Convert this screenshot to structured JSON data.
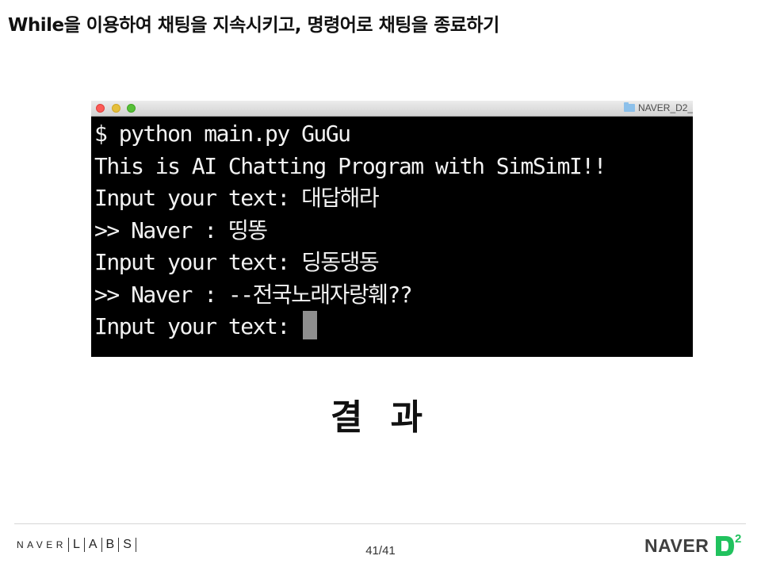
{
  "slide": {
    "title": "While을 이용하여 채팅을 지속시키고, 명령어로 채팅을 종료하기",
    "caption": "결 과",
    "page_number": "41/41"
  },
  "terminal": {
    "window_title": "NAVER_D2_",
    "lines": [
      "$ python main.py GuGu",
      "This is AI Chatting Program with SimSimI!!",
      "Input your text: 대답해라",
      "&gt;&gt; Naver : 띵똥",
      "Input your text: 딩동댕동",
      "&gt;&gt; Naver : --전국노래자랑훼??",
      "Input your text: "
    ]
  },
  "footer": {
    "labs_naver": "NAVER",
    "labs_letters": [
      "L",
      "A",
      "B",
      "S"
    ],
    "d2_naver": "NAVER",
    "d2_mark": "D2"
  },
  "colors": {
    "terminal_bg": "#000000",
    "terminal_text": "#f2f2f2",
    "d2_green": "#21c25e",
    "cursor": "#8e8e8e"
  }
}
